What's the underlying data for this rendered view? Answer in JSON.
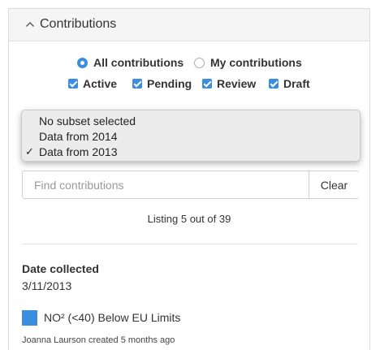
{
  "panel": {
    "title": "Contributions"
  },
  "filters": {
    "scope": [
      {
        "label": "All contributions",
        "selected": true
      },
      {
        "label": "My contributions",
        "selected": false
      }
    ],
    "status": [
      {
        "label": "Active",
        "checked": true
      },
      {
        "label": "Pending",
        "checked": true
      },
      {
        "label": "Review",
        "checked": true
      },
      {
        "label": "Draft",
        "checked": true
      }
    ]
  },
  "subset_dropdown": {
    "selected": "Data from 2013",
    "options": [
      {
        "label": "No subset selected",
        "checked": false
      },
      {
        "label": "Data from 2014",
        "checked": false
      },
      {
        "label": "Data from 2013",
        "checked": true
      }
    ],
    "check_mark": "✓"
  },
  "search": {
    "placeholder": "Find contributions",
    "value": "",
    "clear_label": "Clear"
  },
  "listing": {
    "text": "Listing 5 out of 39"
  },
  "contribution": {
    "field_label": "Date collected",
    "field_value": "3/11/2013",
    "title": "NO² (<40) Below EU Limits",
    "swatch_color": "#3b8de0",
    "meta": "Joanna Laurson created 5 months ago"
  },
  "colors": {
    "accent": "#3b8de0",
    "focus_border": "#f0d77a"
  }
}
